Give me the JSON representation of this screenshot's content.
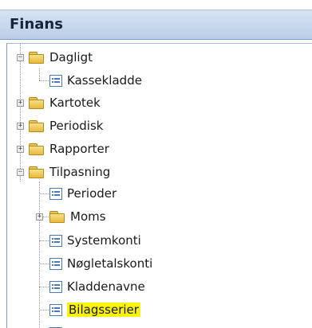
{
  "header": {
    "title": "Finans"
  },
  "tree": {
    "daglig": "Dagligt",
    "kassekladde": "Kassekladde",
    "kartotek": "Kartotek",
    "periodisk": "Periodisk",
    "rapporter": "Rapporter",
    "tilpasning": "Tilpasning",
    "perioder": "Perioder",
    "moms": "Moms",
    "systemkonti": "Systemkonti",
    "noegletalskonti": "Nøgletalskonti",
    "kladdenavne": "Kladdenavne",
    "bilagsserier": "Bilagsserier"
  },
  "highlight_color": "#f9f30a"
}
